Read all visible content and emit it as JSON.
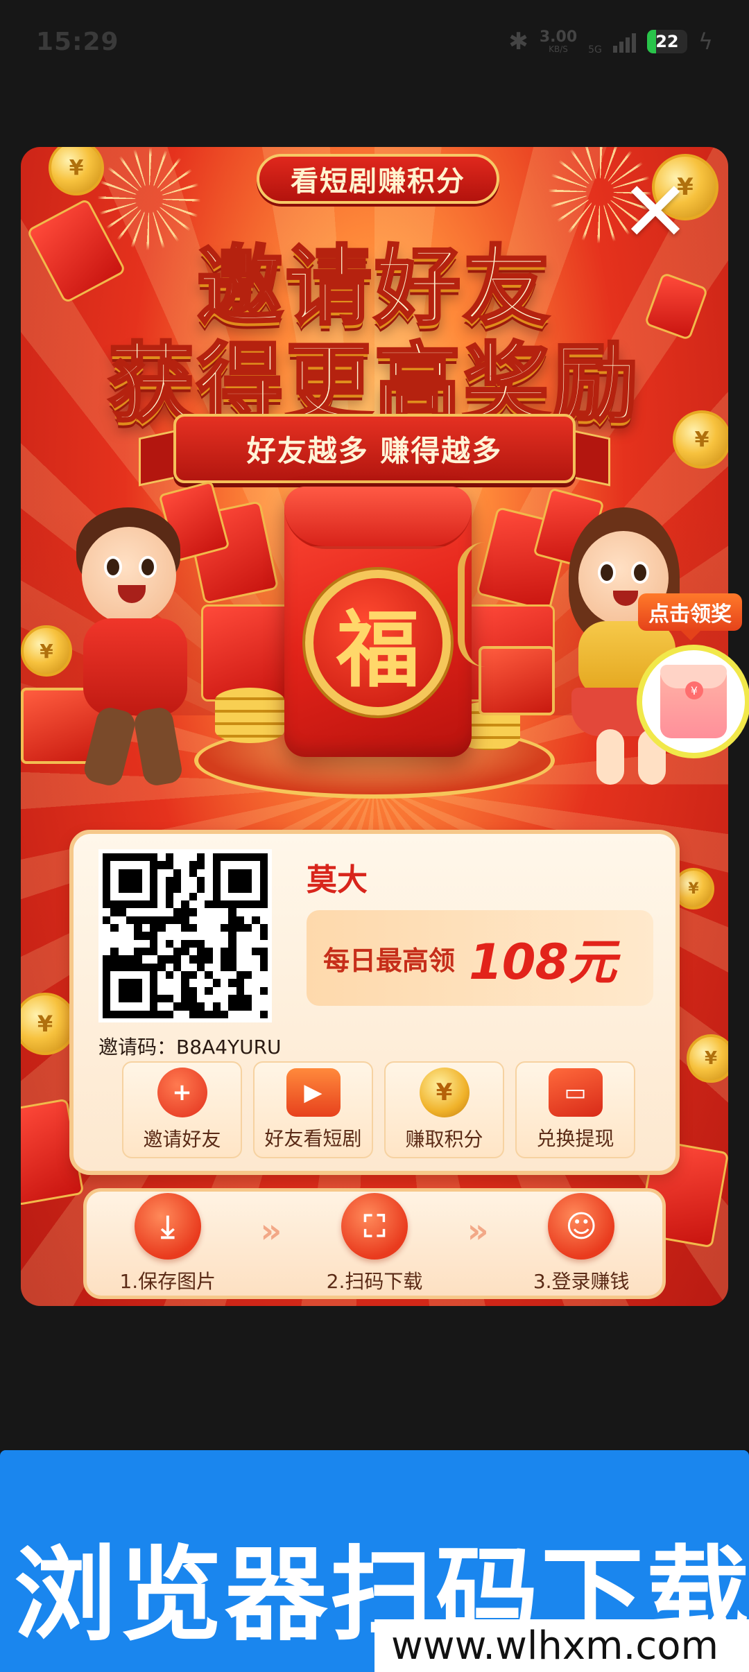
{
  "status_bar": {
    "time": "15:29",
    "net_speed_value": "3.00",
    "net_speed_unit": "KB/S",
    "network_type": "5G",
    "battery_level": "22",
    "battery_fraction": 0.22
  },
  "poster": {
    "tag_title": "看短剧赚积分",
    "headline_line1": "邀请好友",
    "headline_line2": "获得更高奖励",
    "ribbon_text": "好友越多 赚得越多",
    "fu_char": "福",
    "close_symbol": "✕",
    "claim_label": "点击领奖",
    "user_name": "莫大",
    "daily_label": "每日最高领",
    "daily_amount": "108元",
    "invite_code": "邀请码：B8A4YURU",
    "actions": [
      {
        "label": "邀请好友",
        "icon": "invite-user-icon"
      },
      {
        "label": "好友看短剧",
        "icon": "tv-play-icon"
      },
      {
        "label": "赚取积分",
        "icon": "coin-icon"
      },
      {
        "label": "兑换提现",
        "icon": "wallet-icon"
      }
    ],
    "steps": [
      {
        "label": "1.保存图片",
        "icon": "download-icon"
      },
      {
        "label": "2.扫码下载",
        "icon": "scan-icon"
      },
      {
        "label": "3.登录赚钱",
        "icon": "user-icon"
      }
    ]
  },
  "banner": {
    "text": "浏览器扫码下载",
    "url": "www.wlhxm.com"
  },
  "colors": {
    "background": "#171717",
    "poster_red": "#e3241a",
    "gold": "#f5c75a",
    "banner_blue": "#1a86ee",
    "amount_red": "#e2231a"
  }
}
